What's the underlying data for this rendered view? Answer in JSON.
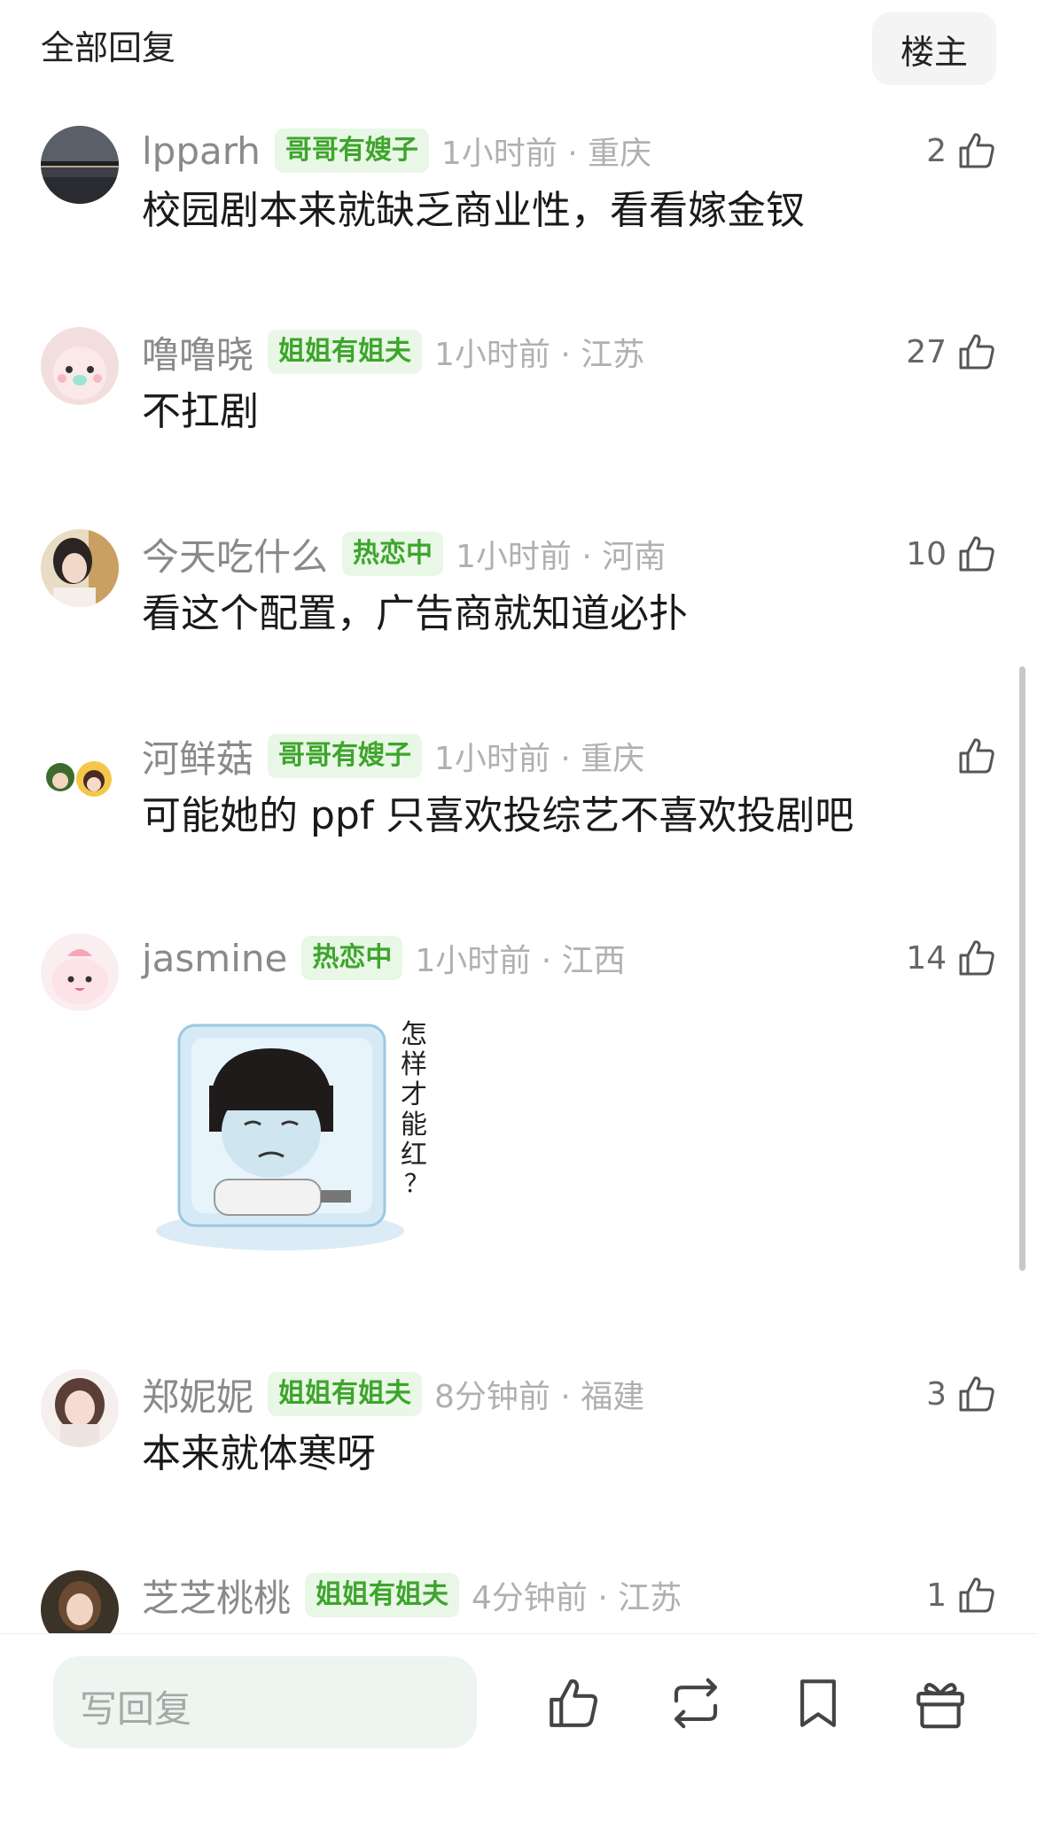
{
  "header": {
    "title": "全部回复",
    "owner_button": "楼主"
  },
  "comments": [
    {
      "name": "lpparh",
      "badge": "哥哥有嫂子",
      "time_loc": "1小时前 · 重庆",
      "likes": "2",
      "text": "校园剧本来就缺乏商业性，看看嫁金钗"
    },
    {
      "name": "噜噜晓",
      "badge": "姐姐有姐夫",
      "time_loc": "1小时前 · 江苏",
      "likes": "27",
      "text": "不扛剧"
    },
    {
      "name": "今天吃什么",
      "badge": "热恋中",
      "time_loc": "1小时前 · 河南",
      "likes": "10",
      "text": "看这个配置，广告商就知道必扑"
    },
    {
      "name": "河鲜菇",
      "badge": "哥哥有嫂子",
      "time_loc": "1小时前 · 重庆",
      "likes": "",
      "text": "可能她的 ppf 只喜欢投综艺不喜欢投剧吧"
    },
    {
      "name": "jasmine",
      "badge": "热恋中",
      "time_loc": "1小时前 · 江西",
      "likes": "14",
      "sticker_text": "怎样才能红？"
    },
    {
      "name": "郑妮妮",
      "badge": "姐姐有姐夫",
      "time_loc": "8分钟前 · 福建",
      "likes": "3",
      "text": "本来就体寒呀"
    },
    {
      "name": "芝芝桃桃",
      "badge": "姐姐有姐夫",
      "time_loc": "4分钟前 · 江苏",
      "likes": "1",
      "text": ""
    }
  ],
  "bottom_bar": {
    "reply_placeholder": "写回复",
    "icons": [
      "thumbs-up-icon",
      "repost-icon",
      "bookmark-icon",
      "gift-icon"
    ]
  },
  "colors": {
    "badge_green": "#3da52c",
    "badge_bg": "#e9f7e6",
    "meta_gray": "#b0b0b0",
    "reply_bg": "#eef5f1"
  }
}
